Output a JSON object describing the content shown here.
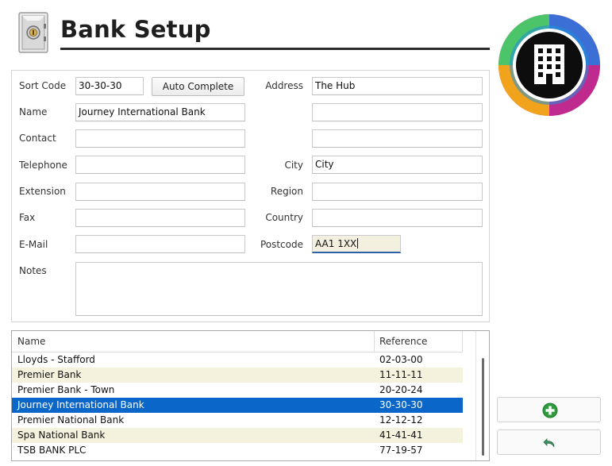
{
  "page": {
    "title": "Bank Setup"
  },
  "form": {
    "sort_code": {
      "label": "Sort Code",
      "value": "30-30-30"
    },
    "auto_complete_label": "Auto Complete",
    "name": {
      "label": "Name",
      "value": "Journey International Bank"
    },
    "contact": {
      "label": "Contact",
      "value": ""
    },
    "telephone": {
      "label": "Telephone",
      "value": ""
    },
    "extension": {
      "label": "Extension",
      "value": ""
    },
    "fax": {
      "label": "Fax",
      "value": ""
    },
    "email": {
      "label": "E-Mail",
      "value": ""
    },
    "notes": {
      "label": "Notes",
      "value": ""
    },
    "address": {
      "label": "Address",
      "line1": "The Hub",
      "line2": "",
      "line3": ""
    },
    "city": {
      "label": "City",
      "value": "City"
    },
    "region": {
      "label": "Region",
      "value": ""
    },
    "country": {
      "label": "Country",
      "value": ""
    },
    "postcode": {
      "label": "Postcode",
      "value": "AA1 1XX"
    }
  },
  "bank_list": {
    "columns": [
      "Name",
      "Reference"
    ],
    "rows": [
      {
        "name": "Lloyds - Stafford",
        "reference": "02-03-00"
      },
      {
        "name": "Premier Bank",
        "reference": "11-11-11"
      },
      {
        "name": "Premier Bank - Town",
        "reference": "20-20-24"
      },
      {
        "name": "Journey International Bank",
        "reference": "30-30-30"
      },
      {
        "name": "Premier National Bank",
        "reference": "12-12-12"
      },
      {
        "name": "Spa National Bank",
        "reference": "41-41-41"
      },
      {
        "name": "TSB BANK PLC",
        "reference": "77-19-57"
      }
    ],
    "selected_index": 3
  },
  "icons": {
    "header": "safe-icon",
    "logo": "building-icon",
    "add": "add-icon",
    "undo": "undo-icon"
  },
  "colors": {
    "selection": "#0a66c8",
    "alt_row": "#f4f2dd",
    "add_green": "#2e9b3c"
  }
}
